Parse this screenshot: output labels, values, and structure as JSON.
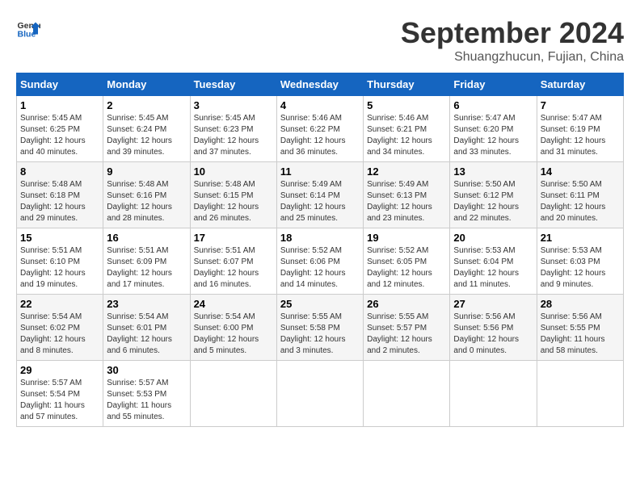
{
  "header": {
    "logo_general": "General",
    "logo_blue": "Blue",
    "month_title": "September 2024",
    "subtitle": "Shuangzhucun, Fujian, China"
  },
  "weekdays": [
    "Sunday",
    "Monday",
    "Tuesday",
    "Wednesday",
    "Thursday",
    "Friday",
    "Saturday"
  ],
  "weeks": [
    [
      {
        "day": "1",
        "sunrise": "5:45 AM",
        "sunset": "6:25 PM",
        "daylight": "12 hours and 40 minutes."
      },
      {
        "day": "2",
        "sunrise": "5:45 AM",
        "sunset": "6:24 PM",
        "daylight": "12 hours and 39 minutes."
      },
      {
        "day": "3",
        "sunrise": "5:45 AM",
        "sunset": "6:23 PM",
        "daylight": "12 hours and 37 minutes."
      },
      {
        "day": "4",
        "sunrise": "5:46 AM",
        "sunset": "6:22 PM",
        "daylight": "12 hours and 36 minutes."
      },
      {
        "day": "5",
        "sunrise": "5:46 AM",
        "sunset": "6:21 PM",
        "daylight": "12 hours and 34 minutes."
      },
      {
        "day": "6",
        "sunrise": "5:47 AM",
        "sunset": "6:20 PM",
        "daylight": "12 hours and 33 minutes."
      },
      {
        "day": "7",
        "sunrise": "5:47 AM",
        "sunset": "6:19 PM",
        "daylight": "12 hours and 31 minutes."
      }
    ],
    [
      {
        "day": "8",
        "sunrise": "5:48 AM",
        "sunset": "6:18 PM",
        "daylight": "12 hours and 29 minutes."
      },
      {
        "day": "9",
        "sunrise": "5:48 AM",
        "sunset": "6:16 PM",
        "daylight": "12 hours and 28 minutes."
      },
      {
        "day": "10",
        "sunrise": "5:48 AM",
        "sunset": "6:15 PM",
        "daylight": "12 hours and 26 minutes."
      },
      {
        "day": "11",
        "sunrise": "5:49 AM",
        "sunset": "6:14 PM",
        "daylight": "12 hours and 25 minutes."
      },
      {
        "day": "12",
        "sunrise": "5:49 AM",
        "sunset": "6:13 PM",
        "daylight": "12 hours and 23 minutes."
      },
      {
        "day": "13",
        "sunrise": "5:50 AM",
        "sunset": "6:12 PM",
        "daylight": "12 hours and 22 minutes."
      },
      {
        "day": "14",
        "sunrise": "5:50 AM",
        "sunset": "6:11 PM",
        "daylight": "12 hours and 20 minutes."
      }
    ],
    [
      {
        "day": "15",
        "sunrise": "5:51 AM",
        "sunset": "6:10 PM",
        "daylight": "12 hours and 19 minutes."
      },
      {
        "day": "16",
        "sunrise": "5:51 AM",
        "sunset": "6:09 PM",
        "daylight": "12 hours and 17 minutes."
      },
      {
        "day": "17",
        "sunrise": "5:51 AM",
        "sunset": "6:07 PM",
        "daylight": "12 hours and 16 minutes."
      },
      {
        "day": "18",
        "sunrise": "5:52 AM",
        "sunset": "6:06 PM",
        "daylight": "12 hours and 14 minutes."
      },
      {
        "day": "19",
        "sunrise": "5:52 AM",
        "sunset": "6:05 PM",
        "daylight": "12 hours and 12 minutes."
      },
      {
        "day": "20",
        "sunrise": "5:53 AM",
        "sunset": "6:04 PM",
        "daylight": "12 hours and 11 minutes."
      },
      {
        "day": "21",
        "sunrise": "5:53 AM",
        "sunset": "6:03 PM",
        "daylight": "12 hours and 9 minutes."
      }
    ],
    [
      {
        "day": "22",
        "sunrise": "5:54 AM",
        "sunset": "6:02 PM",
        "daylight": "12 hours and 8 minutes."
      },
      {
        "day": "23",
        "sunrise": "5:54 AM",
        "sunset": "6:01 PM",
        "daylight": "12 hours and 6 minutes."
      },
      {
        "day": "24",
        "sunrise": "5:54 AM",
        "sunset": "6:00 PM",
        "daylight": "12 hours and 5 minutes."
      },
      {
        "day": "25",
        "sunrise": "5:55 AM",
        "sunset": "5:58 PM",
        "daylight": "12 hours and 3 minutes."
      },
      {
        "day": "26",
        "sunrise": "5:55 AM",
        "sunset": "5:57 PM",
        "daylight": "12 hours and 2 minutes."
      },
      {
        "day": "27",
        "sunrise": "5:56 AM",
        "sunset": "5:56 PM",
        "daylight": "12 hours and 0 minutes."
      },
      {
        "day": "28",
        "sunrise": "5:56 AM",
        "sunset": "5:55 PM",
        "daylight": "11 hours and 58 minutes."
      }
    ],
    [
      {
        "day": "29",
        "sunrise": "5:57 AM",
        "sunset": "5:54 PM",
        "daylight": "11 hours and 57 minutes."
      },
      {
        "day": "30",
        "sunrise": "5:57 AM",
        "sunset": "5:53 PM",
        "daylight": "11 hours and 55 minutes."
      },
      null,
      null,
      null,
      null,
      null
    ]
  ]
}
